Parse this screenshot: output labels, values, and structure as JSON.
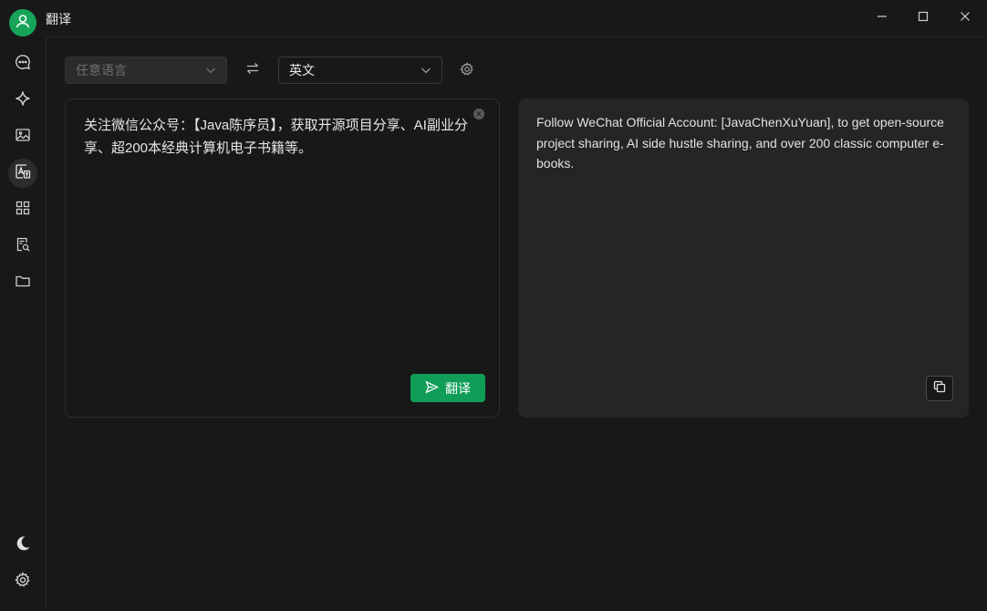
{
  "app": {
    "title": "翻译"
  },
  "window_controls": [
    "minimize-icon",
    "maximize-icon",
    "close-icon"
  ],
  "sidebar": {
    "items": [
      {
        "name": "chat",
        "icon": "chat-bubble-icon"
      },
      {
        "name": "sparkle",
        "icon": "sparkle-icon"
      },
      {
        "name": "image",
        "icon": "image-icon"
      },
      {
        "name": "translate",
        "icon": "translate-icon",
        "active": true
      },
      {
        "name": "apps",
        "icon": "grid-icon"
      },
      {
        "name": "doc-search",
        "icon": "document-search-icon"
      },
      {
        "name": "files",
        "icon": "folder-icon"
      }
    ],
    "bottom": [
      {
        "name": "theme",
        "icon": "moon-icon"
      },
      {
        "name": "settings",
        "icon": "gear-icon"
      }
    ]
  },
  "translator": {
    "source_lang_placeholder": "任意语言",
    "target_lang": "英文",
    "source_text": "关注微信公众号：【Java陈序员】，获取开源项目分享、AI副业分享、超200本经典计算机电子书籍等。",
    "translate_label": "翻译",
    "output_text": "Follow WeChat Official Account: [JavaChenXuYuan], to get open-source project sharing, AI side hustle sharing, and over 200 classic computer e-books."
  },
  "colors": {
    "accent": "#0f9d58",
    "background": "#181818",
    "panel": "#252525"
  }
}
